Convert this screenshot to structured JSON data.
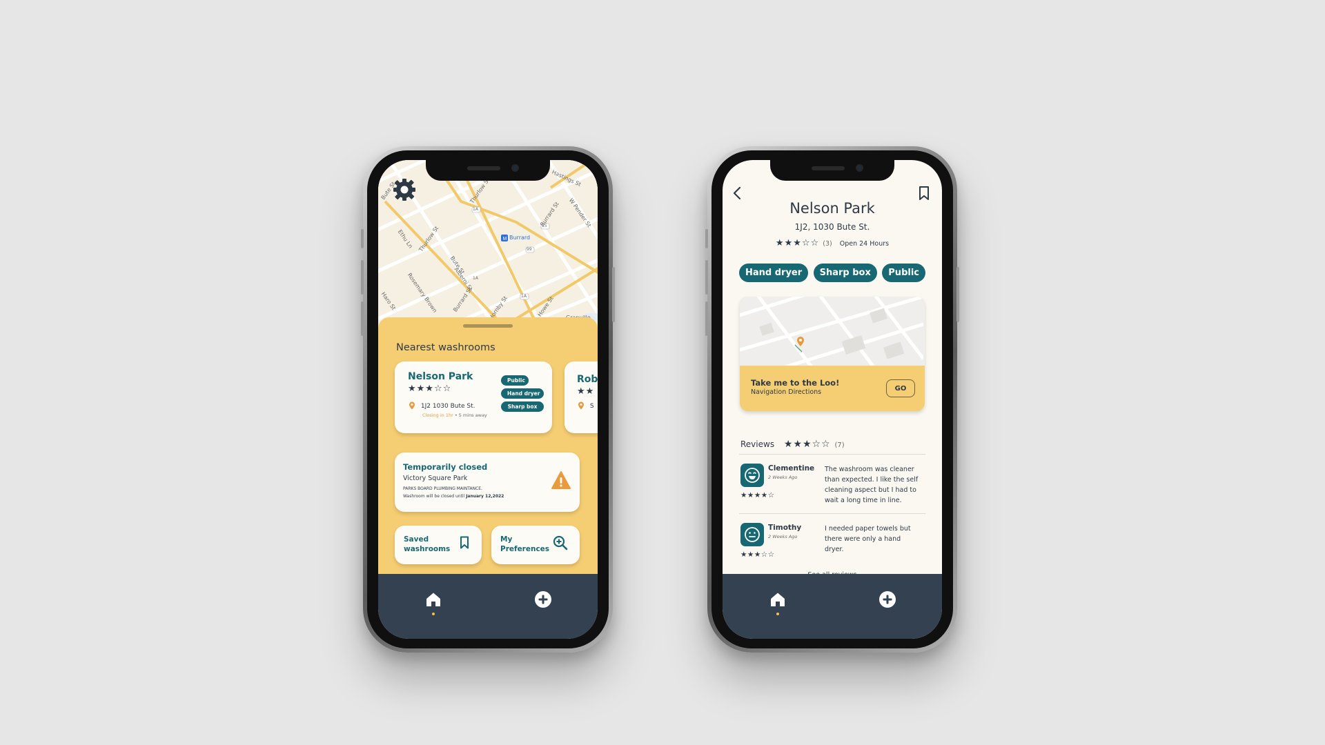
{
  "colors": {
    "background": "#e6e6e6",
    "accent_teal": "#176872",
    "sheet_yellow": "#f5cd72",
    "nav_dark": "#344150",
    "warning_orange": "#e89a3c"
  },
  "left_screen": {
    "map": {
      "streets": [
        "Thurlow St",
        "W Pender St",
        "Burrard St",
        "Hastings St",
        "Thurlow St",
        "Alberni St",
        "Bute St",
        "Ethu Ln",
        "Rosemary Brown",
        "Burrard St",
        "Hornby St",
        "Howe St",
        "Granville",
        "Haro St",
        "Bute St"
      ],
      "station_label": "Burrard",
      "route_badges": [
        "1A",
        "99",
        "1A",
        "15",
        "1A"
      ]
    },
    "settings_icon": "gear-icon",
    "sheet_title": "Nearest washrooms",
    "nearest_card": {
      "name": "Nelson Park",
      "stars": "★★★☆☆",
      "address": "1J2 1030 Bute St.",
      "closing": "Closing in 1hr",
      "distance": "• 5 mins away",
      "tags": [
        "Public",
        "Hand dryer",
        "Sharp box"
      ]
    },
    "peek_card": {
      "name": "Rob",
      "stars": "★★",
      "address": "S"
    },
    "closed_card": {
      "title": "Temporarily closed",
      "place": "Victory Square Park",
      "notice": "PARKS BOARD PLUMBING MAINTANCE.",
      "notice_detail_prefix": "Washroom will be closed until ",
      "notice_date": "January 12,2022"
    },
    "quick_saved": {
      "label_line1": "Saved",
      "label_line2": "washrooms"
    },
    "quick_prefs": {
      "label_line1": "My",
      "label_line2": "Preferences"
    }
  },
  "right_screen": {
    "title": "Nelson Park",
    "address": "1J2, 1030 Bute St.",
    "stars": "★★★☆☆",
    "rating_count": "(3)",
    "hours": "Open 24 Hours",
    "tags": [
      "Hand dryer",
      "Sharp box",
      "Public"
    ],
    "nav_cta_title": "Take me to the Loo!",
    "nav_cta_sub": "Navigation Directions",
    "go_label": "GO",
    "reviews_label": "Reviews",
    "reviews_stars": "★★★☆☆",
    "reviews_count": "(7)",
    "reviews": [
      {
        "name": "Clementine",
        "ago": "2 Weeks Ago",
        "stars": "★★★★☆",
        "text": "The washroom was cleaner than expected. I like the self cleaning aspect but I had to wait a long time in line.",
        "face": "smile-face-icon"
      },
      {
        "name": "Timothy",
        "ago": "2 Weeks Ago",
        "stars": "★★★☆☆",
        "text": "I needed paper towels but there were only a hand dryer.",
        "face": "neutral-face-icon"
      }
    ],
    "see_all": "See all reviews"
  },
  "bottom_nav": {
    "home_icon": "home-icon",
    "add_icon": "plus-circle-icon"
  }
}
